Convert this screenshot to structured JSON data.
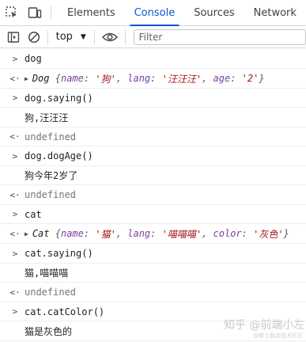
{
  "tabs": [
    {
      "label": "Elements"
    },
    {
      "label": "Console"
    },
    {
      "label": "Sources"
    },
    {
      "label": "Network"
    }
  ],
  "toolbar": {
    "context": "top",
    "filter_placeholder": "Filter"
  },
  "rows": {
    "r1": "dog",
    "r2": {
      "class": "Dog",
      "key1": "name",
      "val1": "'狗'",
      "key2": "lang",
      "val2": "'汪汪汪'",
      "key3": "age",
      "val3": "'2'"
    },
    "r3": "dog.saying()",
    "r4": "狗,汪汪汪",
    "r5": "undefined",
    "r6": "dog.dogAge()",
    "r7": "狗今年2岁了",
    "r8": "undefined",
    "r9": "cat",
    "r10": {
      "class": "Cat",
      "key1": "name",
      "val1": "'猫'",
      "key2": "lang",
      "val2": "'喵喵喵'",
      "key3": "color",
      "val3": "'灰色'"
    },
    "r11": "cat.saying()",
    "r12": "猫,喵喵喵",
    "r13": "undefined",
    "r14": "cat.catColor()",
    "r15": "猫是灰色的"
  },
  "watermark": {
    "main": "知乎 @前端小左",
    "sub": "@稀土掘金技术社区"
  }
}
